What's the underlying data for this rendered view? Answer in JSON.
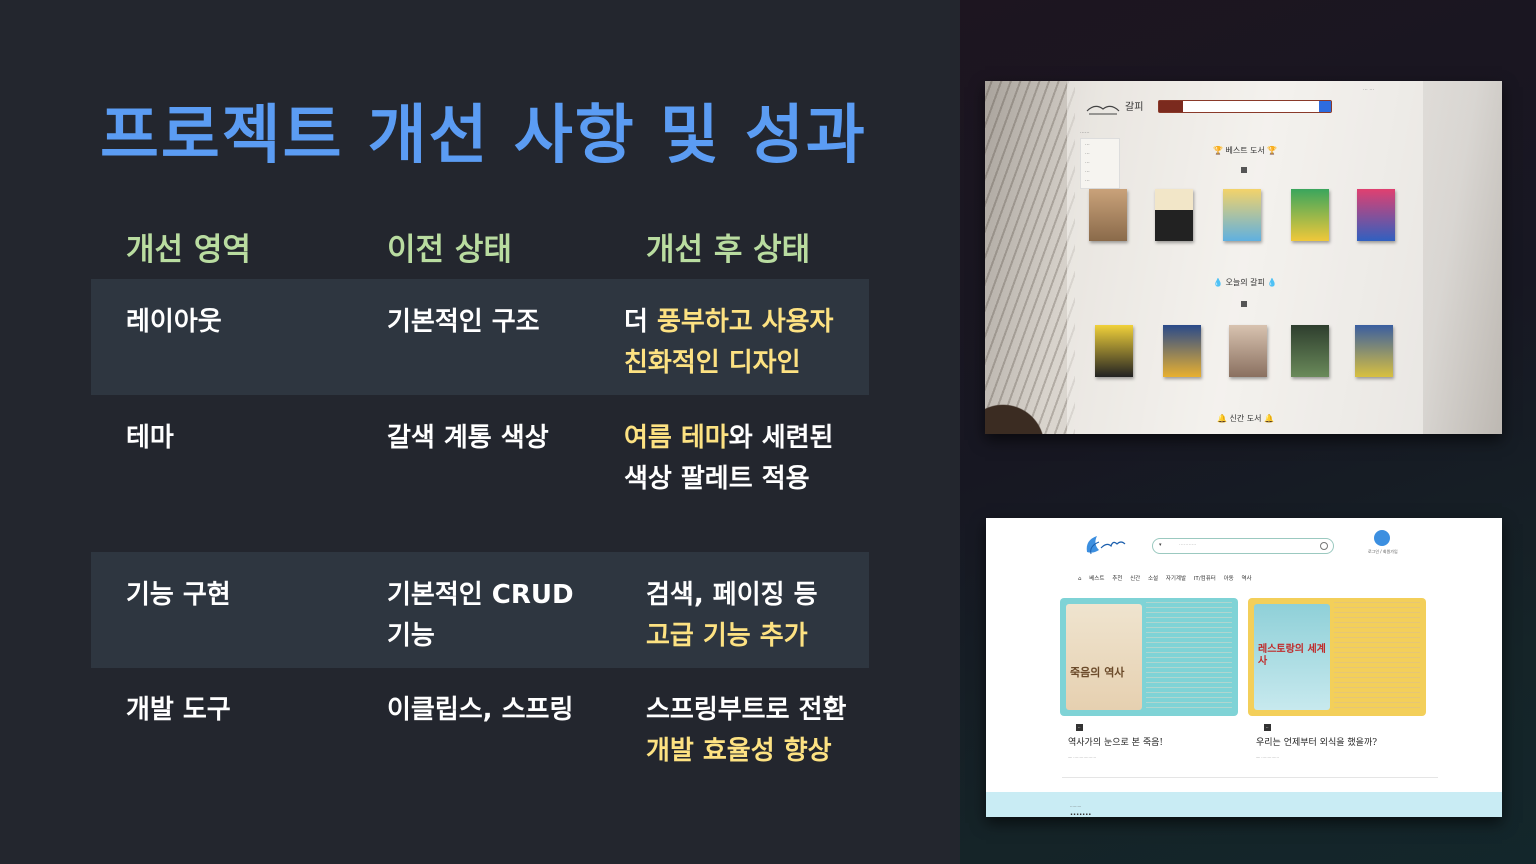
{
  "title": "프로젝트 개선 사항 및 성과",
  "headers": {
    "area": "개선 영역",
    "before": "이전 상태",
    "after": "개선 후 상태"
  },
  "rows": [
    {
      "area": "레이아웃",
      "before": "기본적인 구조",
      "after1_plain": "더 ",
      "after1_hl": "풍부하고 사용자",
      "after2_hl": "친화적인 디자인"
    },
    {
      "area": "테마",
      "before": "갈색 계통 색상",
      "after1_hl": "여름 테마",
      "after1_plain": "와 세련된",
      "after2_plain": "색상 팔레트 적용"
    },
    {
      "area": "기능 구현",
      "before1": "기본적인 CRUD",
      "before2": "기능",
      "after1_plain": "검색, 페이징 등",
      "after2_hl": "고급 기능 추가"
    },
    {
      "area": "개발 도구",
      "before": "이클립스, 스프링",
      "after1_plain": "스프링부트로 전환",
      "after2_hl": "개발 효율성 향상"
    }
  ],
  "colors": {
    "title": "#5b9cf3",
    "header": "#b9dca0",
    "highlight": "#fde282",
    "row_band": "#2e3640"
  },
  "shot_old": {
    "site_name": "갈피",
    "section_best": "🏆 베스트 도서 🏆",
    "section_today": "💧 오늘의 갈피 💧",
    "section_new": "🔔 신간 도서 🔔"
  },
  "shot_new": {
    "login": "로그인 / 회원가입",
    "nav": [
      "베스트",
      "추천",
      "신간",
      "소설",
      "자기계발",
      "IT/컴퓨터",
      "아동",
      "역사"
    ],
    "card1_cover": "죽음의 역사",
    "card2_cover": "레스토랑의 세계사",
    "card1_caption": "역사가의 눈으로 본 죽음!",
    "card2_caption": "우리는 언제부터 외식을 했을까?"
  }
}
